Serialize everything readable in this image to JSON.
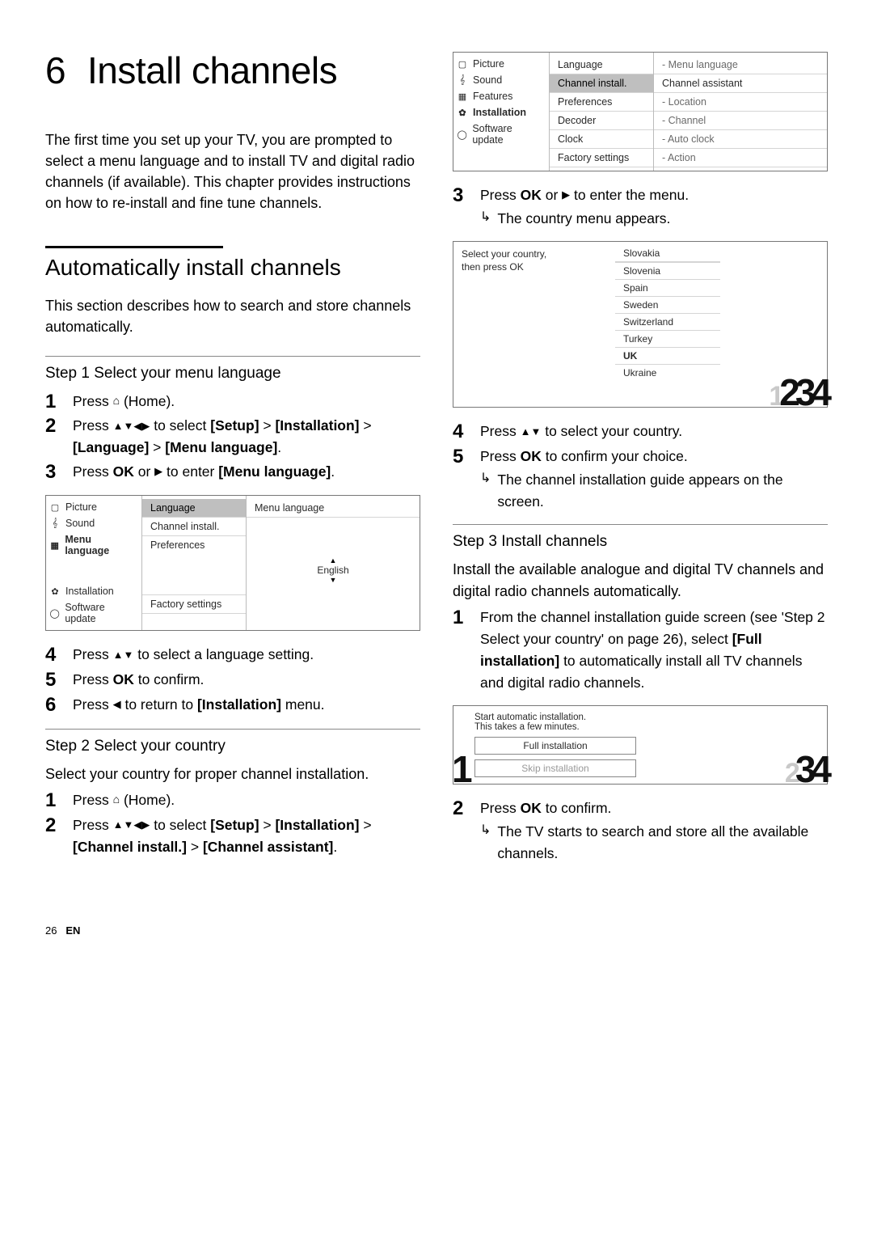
{
  "chapter_number": "6",
  "chapter_title": "Install channels",
  "intro": "The first time you set up your TV, you are prompted to select a menu language and to install TV and digital radio channels (if available). This chapter provides instructions on how to re-install and fine tune channels.",
  "section_title": "Automatically install channels",
  "section_lead": "This section describes how to search and store channels automatically.",
  "step1": {
    "heading": "Step 1 Select your menu language",
    "s1_a": "Press ",
    "s1_b": " (Home).",
    "s2_a": "Press ",
    "s2_b": " to select ",
    "s2_c": "[Setup]",
    "s2_d": " > ",
    "s2_e": "[Installation]",
    "s2_f": " > ",
    "s2_g": "[Language]",
    "s2_h": " > ",
    "s2_i": "[Menu language]",
    "s2_j": ".",
    "s3_a": "Press ",
    "s3_b": "OK",
    "s3_c": " or ",
    "s3_d": " to enter ",
    "s3_e": "[Menu language]",
    "s3_f": ".",
    "s4_a": "Press ",
    "s4_b": " to select a language setting.",
    "s5_a": "Press ",
    "s5_b": "OK",
    "s5_c": " to confirm.",
    "s6_a": "Press ",
    "s6_b": " to return to ",
    "s6_c": "[Installation]",
    "s6_d": " menu."
  },
  "ui1": {
    "side": [
      "Picture",
      "Sound",
      "Menu language",
      "Installation",
      "Software update"
    ],
    "mid": [
      "Language",
      "Channel install.",
      "Preferences",
      "Factory settings"
    ],
    "right_top": "Menu language",
    "spinner_value": "English"
  },
  "step2": {
    "heading": "Step 2 Select your country",
    "lead": "Select your country for proper channel installation.",
    "s1_a": "Press ",
    "s1_b": " (Home).",
    "s2_a": "Press ",
    "s2_b": " to select ",
    "s2_c": "[Setup]",
    "s2_d": " > ",
    "s2_e": "[Installation]",
    "s2_f": " > ",
    "s2_g": "[Channel install.]",
    "s2_h": " > ",
    "s2_i": "[Channel assistant]",
    "s2_j": "."
  },
  "ui2": {
    "side": [
      "Picture",
      "Sound",
      "Features",
      "Installation",
      "Software update"
    ],
    "mid": [
      "Language",
      "Channel install.",
      "Preferences",
      "Decoder",
      "Clock",
      "Factory settings"
    ],
    "right": [
      "- Menu language",
      "Channel assistant",
      "- Location",
      "- Channel",
      "- Auto clock",
      "- Action"
    ]
  },
  "rcol_steps_a": {
    "s3_a": "Press ",
    "s3_b": "OK",
    "s3_c": " or ",
    "s3_d": " to enter the menu.",
    "r3": "The country menu appears."
  },
  "country_ui": {
    "prompt_l1": "Select your country,",
    "prompt_l2": "then press OK",
    "items": [
      "Slovakia",
      "Slovenia",
      "Spain",
      "Sweden",
      "Switzerland",
      "Turkey",
      "UK",
      "Ukraine"
    ],
    "selected": "UK",
    "faint_digit": "1",
    "dark_digits": "234"
  },
  "rcol_steps_b": {
    "s4_a": "Press ",
    "s4_b": " to select your country.",
    "s5_a": "Press ",
    "s5_b": "OK",
    "s5_c": " to confirm your choice.",
    "r5": "The channel installation guide appears on the screen."
  },
  "step3": {
    "heading": "Step 3 Install channels",
    "lead": "Install the available analogue and digital TV channels and digital radio channels automatically.",
    "s1_a": "From the channel installation guide screen (see 'Step 2 Select your country' on page 26), select ",
    "s1_b": "[Full installation]",
    "s1_c": " to automatically install all TV channels and digital radio channels."
  },
  "install_ui": {
    "line1": "Start automatic installation.",
    "line2": "This takes a few minutes.",
    "btn1": "Full installation",
    "btn2": "Skip installation",
    "dark_left": "1",
    "faint": "2",
    "dark_right": "34"
  },
  "rcol_steps_c": {
    "s2_a": "Press ",
    "s2_b": "OK",
    "s2_c": " to confirm.",
    "r2": "The TV starts to search and store all the available channels."
  },
  "footer_page": "26",
  "footer_lang": "EN"
}
